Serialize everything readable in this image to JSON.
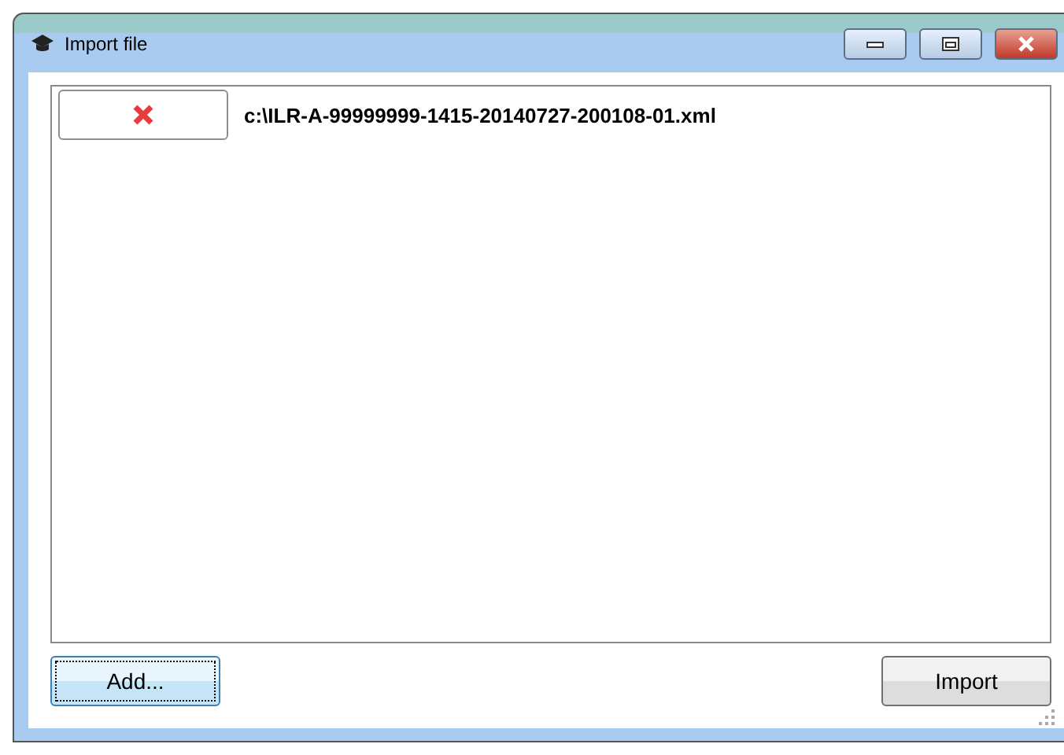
{
  "window": {
    "title": "Import file"
  },
  "files": [
    {
      "path": "c:\\ILR-A-99999999-1415-20140727-200108-01.xml"
    }
  ],
  "add_button": {
    "label": "Add...",
    "focused": true
  },
  "import_button": {
    "label": "Import",
    "focused": false
  }
}
